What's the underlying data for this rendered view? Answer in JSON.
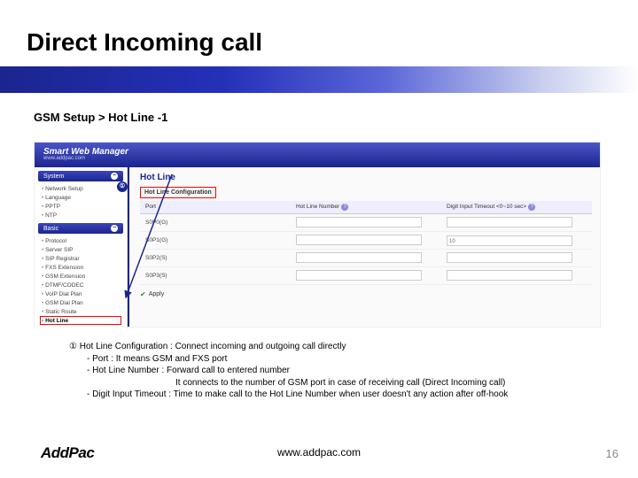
{
  "title": "Direct Incoming call",
  "breadcrumb": "GSM Setup > Hot Line -1",
  "swm": {
    "brand": "Smart Web Manager",
    "sub": "www.addpac.com"
  },
  "sidebar": {
    "section1": "System",
    "items1": [
      "Network Setup",
      "Language",
      "PPTP",
      "NTP"
    ],
    "section2": "Basic",
    "items2": [
      "Protocol",
      "Server SIP",
      "SIP Registrar",
      "FXS Extension",
      "GSM Extension",
      "DTMF/CODEC",
      "VoIP Dial Plan",
      "GSM Dial Plan",
      "Static Route",
      "Hot Line"
    ]
  },
  "content": {
    "heading": "Hot Line",
    "section": "Hot Line Configuration",
    "badge": "①",
    "columns": {
      "port": "Port",
      "number": "Hot Line Number",
      "timeout": "Digit Input Timeout <0~10 sec>"
    },
    "rows": [
      {
        "port": "S0P0(G)",
        "timeout": ""
      },
      {
        "port": "S0P1(G)",
        "timeout": "10"
      },
      {
        "port": "S0P2(S)",
        "timeout": ""
      },
      {
        "port": "S0P3(S)",
        "timeout": ""
      }
    ],
    "apply": "Apply"
  },
  "notes": {
    "line1": "① Hot Line Configuration : Connect incoming and outgoing call directly",
    "line2": "- Port : It means GSM and FXS port",
    "line3": "- Hot Line Number : Forward call to entered number",
    "line4": "It connects to the number of GSM port in case of receiving call (Direct Incoming call)",
    "line5": "- Digit Input Timeout : Time to make call to the Hot Line Number when user doesn't any action after off-hook"
  },
  "footer": {
    "logo": "AddPac",
    "url": "www.addpac.com",
    "page": "16"
  }
}
